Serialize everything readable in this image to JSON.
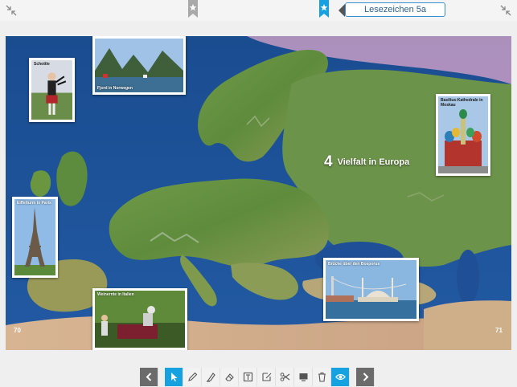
{
  "topbar": {
    "bookmark_field": {
      "value": "Lesezeichen 5a"
    },
    "icons": {
      "left_collapse": "collapse-arrows-icon",
      "ribbon_grey": "star-ribbon-icon",
      "ribbon_blue": "star-ribbon-icon",
      "right_collapse": "collapse-arrows-icon"
    }
  },
  "page": {
    "chapter_number": "4",
    "chapter_title": "Vielfalt in Europa",
    "page_left": "70",
    "page_right": "71",
    "photos": {
      "scotland": "Schottle",
      "norway": "Fjord in Norwegen",
      "moscow": "Basilius-Kathedrale in Moskau",
      "paris": "Eiffelturm in Paris",
      "italy": "Weinernte in Italien",
      "bosporus": "Brücke über den Bosporus"
    }
  },
  "toolbar": {
    "tools": [
      "chevron-left-icon",
      "pointer-icon",
      "pencil-icon",
      "highlighter-icon",
      "eraser-icon",
      "text-box-icon",
      "note-icon",
      "scissors-icon",
      "screen-icon",
      "trash-icon",
      "eye-icon",
      "chevron-right-icon"
    ],
    "active_tools": [
      "pointer-icon",
      "eye-icon"
    ]
  },
  "colors": {
    "accent": "#16a1e0",
    "sea": "#1c4f92",
    "land": "#5f8c3c",
    "toolbar_nav": "#6b6b6b"
  }
}
